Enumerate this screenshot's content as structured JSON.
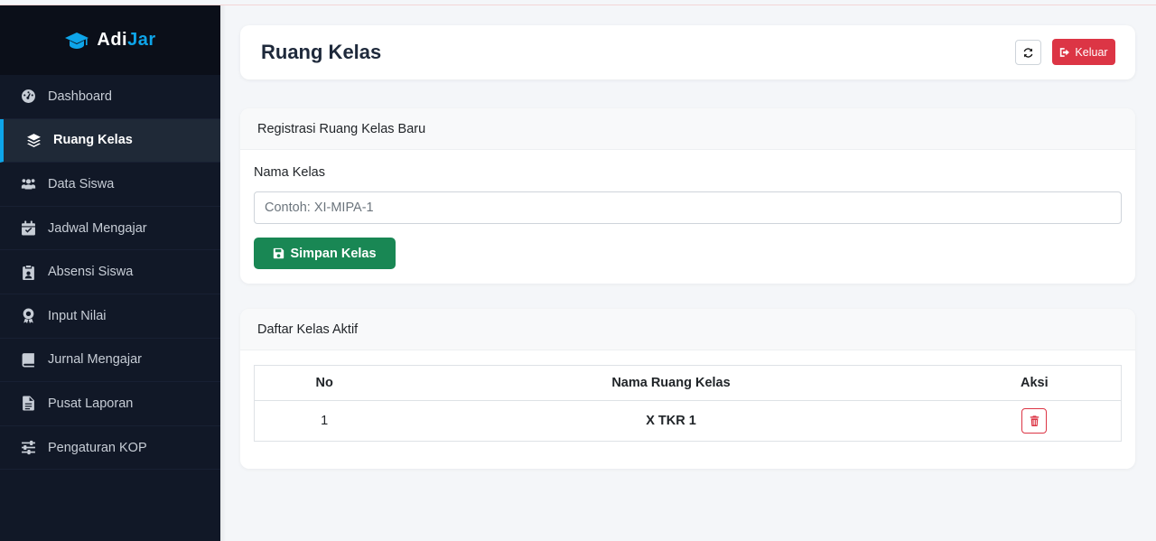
{
  "brand": {
    "part1": "Adi",
    "part2": "Jar",
    "accent": "#0ea5e9"
  },
  "sidebar": {
    "items": [
      {
        "label": "Dashboard",
        "icon": "dashboard-gauge-icon"
      },
      {
        "label": "Ruang Kelas",
        "icon": "layers-icon",
        "active": true
      },
      {
        "label": "Data Siswa",
        "icon": "users-icon"
      },
      {
        "label": "Jadwal Mengajar",
        "icon": "calendar-check-icon"
      },
      {
        "label": "Absensi Siswa",
        "icon": "clipboard-user-icon"
      },
      {
        "label": "Input Nilai",
        "icon": "award-icon"
      },
      {
        "label": "Jurnal Mengajar",
        "icon": "book-icon"
      },
      {
        "label": "Pusat Laporan",
        "icon": "file-lines-icon"
      },
      {
        "label": "Pengaturan KOP",
        "icon": "sliders-icon"
      }
    ]
  },
  "header": {
    "title": "Ruang Kelas",
    "logout_label": "Keluar"
  },
  "form": {
    "card_title": "Registrasi Ruang Kelas Baru",
    "field_label": "Nama Kelas",
    "field_placeholder": "Contoh: XI-MIPA-1",
    "field_value": "",
    "save_label": "Simpan Kelas"
  },
  "list": {
    "card_title": "Daftar Kelas Aktif",
    "columns": [
      "No",
      "Nama Ruang Kelas",
      "Aksi"
    ],
    "rows": [
      {
        "no": "1",
        "name": "X TKR 1"
      }
    ]
  },
  "colors": {
    "sidebar_bg": "#111827",
    "danger": "#dc3545",
    "success": "#198754"
  }
}
